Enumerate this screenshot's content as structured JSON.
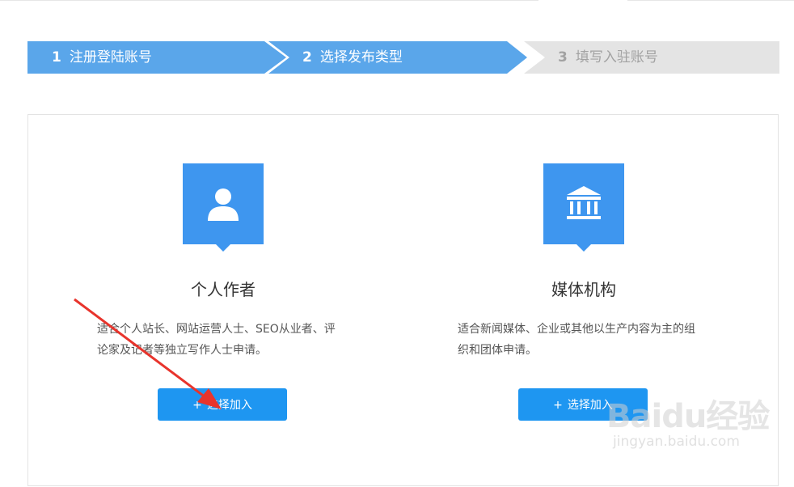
{
  "steps": [
    {
      "num": "1",
      "label": "注册登陆账号",
      "state": "done"
    },
    {
      "num": "2",
      "label": "选择发布类型",
      "state": "active"
    },
    {
      "num": "3",
      "label": "填写入驻账号",
      "state": "pending"
    }
  ],
  "cards": [
    {
      "icon": "person-icon",
      "title": "个人作者",
      "desc": "适合个人站长、网站运营人士、SEO从业者、评论家及记者等独立写作人士申请。",
      "button": {
        "plus": "+",
        "label": "选择加入"
      }
    },
    {
      "icon": "institution-icon",
      "title": "媒体机构",
      "desc": "适合新闻媒体、企业或其他以生产内容为主的组织和团体申请。",
      "button": {
        "plus": "+",
        "label": "选择加入"
      }
    }
  ],
  "watermark": {
    "logo": "Baidu经验",
    "url": "jingyan.baidu.com"
  },
  "colors": {
    "accent": "#3e96ef",
    "step_active": "#5aa6ea",
    "step_pending": "#e4e4e4",
    "button": "#1e96f1",
    "arrow": "#e8342c"
  }
}
